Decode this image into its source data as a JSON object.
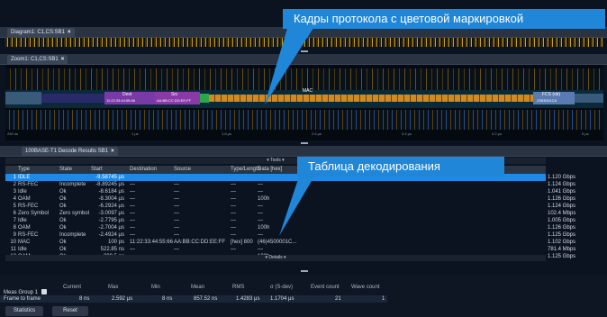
{
  "top_tab": {
    "label": "Diagram1: C1,CS:SB1"
  },
  "zoom_tab": {
    "label": "Zoom1: C1,CS:SB1"
  },
  "decode_tab": {
    "label": "100BASE-T1 Decode Results SB1"
  },
  "close_glyph": "×",
  "callouts": {
    "frames": "Кадры протокола с цветовой маркировкой",
    "table": "Таблица декодирования"
  },
  "frame_labels": {
    "dest": "Dest",
    "dest_value": "11:22:33:44:55:66",
    "src": "Src",
    "src_value": "AA:BB:CC:DD:EE:FF",
    "mac": "MAC",
    "fcs": "FCS (ok)",
    "fcs_value": "23B3D51C8"
  },
  "time_labels": [
    "250 ns",
    "1 μs",
    "1.8 μs",
    "2.6 μs",
    "3.4 μs",
    "4.2 μs",
    "5 μs"
  ],
  "tools_label": "▾ Tools ▾",
  "details_label": "▾ Details ▾",
  "table": {
    "columns": [
      "Type",
      "State",
      "Start",
      "Destination",
      "Source",
      "Type/Length",
      "Data [hex]"
    ],
    "rows": [
      {
        "num": "1",
        "type": "IDLE",
        "state": "",
        "start": "-9.58745 μs",
        "dest": "",
        "src": "",
        "len": "",
        "data": "",
        "speed": "1.120 Gbps",
        "selected": true
      },
      {
        "num": "2",
        "type": "RS-FEC",
        "state": "Incomplete",
        "start": "-8.89245 μs",
        "dest": "—",
        "src": "—",
        "len": "—",
        "data": "—",
        "speed": "1.124 Gbps",
        "selected": false
      },
      {
        "num": "3",
        "type": "Idle",
        "state": "Ok",
        "start": "-8.6184 μs",
        "dest": "—",
        "src": "—",
        "len": "—",
        "data": "—",
        "speed": "1.041 Gbps",
        "selected": false
      },
      {
        "num": "4",
        "type": "OAM",
        "state": "Ok",
        "start": "-8.3004 μs",
        "dest": "—",
        "src": "—",
        "len": "—",
        "data": "100h",
        "speed": "1.126 Gbps",
        "selected": false
      },
      {
        "num": "5",
        "type": "RS-FEC",
        "state": "Ok",
        "start": "-6.2924 μs",
        "dest": "—",
        "src": "—",
        "len": "—",
        "data": "—",
        "speed": "1.124 Gbps",
        "selected": false
      },
      {
        "num": "6",
        "type": "Zero Symbol",
        "state": "Zero symbol r",
        "start": "-3.0097 μs",
        "dest": "—",
        "src": "—",
        "len": "—",
        "data": "—",
        "speed": "102.4 Mbps",
        "selected": false
      },
      {
        "num": "7",
        "type": "Idle",
        "state": "Ok",
        "start": "-2.7795 μs",
        "dest": "—",
        "src": "—",
        "len": "—",
        "data": "—",
        "speed": "1.005 Gbps",
        "selected": false
      },
      {
        "num": "8",
        "type": "OAM",
        "state": "Ok",
        "start": "-2.7004 μs",
        "dest": "—",
        "src": "—",
        "len": "—",
        "data": "100h",
        "speed": "1.126 Gbps",
        "selected": false
      },
      {
        "num": "9",
        "type": "RS-FEC",
        "state": "Incomplete",
        "start": "-2.4924 μs",
        "dest": "—",
        "src": "—",
        "len": "—",
        "data": "—",
        "speed": "1.125 Gbps",
        "selected": false
      },
      {
        "num": "10",
        "type": "MAC",
        "state": "Ok",
        "start": "100 ps",
        "dest": "11:22:33:44:55:66",
        "src": "AA:BB:CC:DD:EE:FF",
        "len": "[hex] 800",
        "data": "(46)4500001C...",
        "speed": "1.102 Gbps",
        "selected": false
      },
      {
        "num": "11",
        "type": "Idle",
        "state": "Ok",
        "start": "522.85 ns",
        "dest": "—",
        "src": "—",
        "len": "—",
        "data": "—",
        "speed": "781.4 Mbps",
        "selected": false
      },
      {
        "num": "12",
        "type": "OAM",
        "state": "Ok",
        "start": "399.5 ns",
        "dest": "—",
        "src": "—",
        "len": "—",
        "data": "100h",
        "speed": "1.125 Gbps",
        "selected": false
      }
    ]
  },
  "measurements": {
    "headers": [
      "Current",
      "Max",
      "Min",
      "Mean",
      "RMS",
      "σ (S-dev)",
      "Event count",
      "Wave count"
    ],
    "group_label": "Meas Group 1",
    "row_label": "Frame to frame",
    "values": [
      "8 ns",
      "2.592 μs",
      "8 ns",
      "857.52 ns",
      "1.4283 μs",
      "1.1704 μs",
      "21",
      "1"
    ]
  },
  "buttons": {
    "statistics": "Statistics",
    "reset": "Reset"
  },
  "colors": {
    "callout": "#1f86d8",
    "selected_row": "#1f8ae6",
    "waveform": "#c8a01a",
    "dest_block": "#7a3aa6",
    "src_block": "#8a3aa6",
    "green_block": "#2aa84a",
    "fcs_block": "#5a7ab0",
    "orange_block": "#d08a20"
  }
}
